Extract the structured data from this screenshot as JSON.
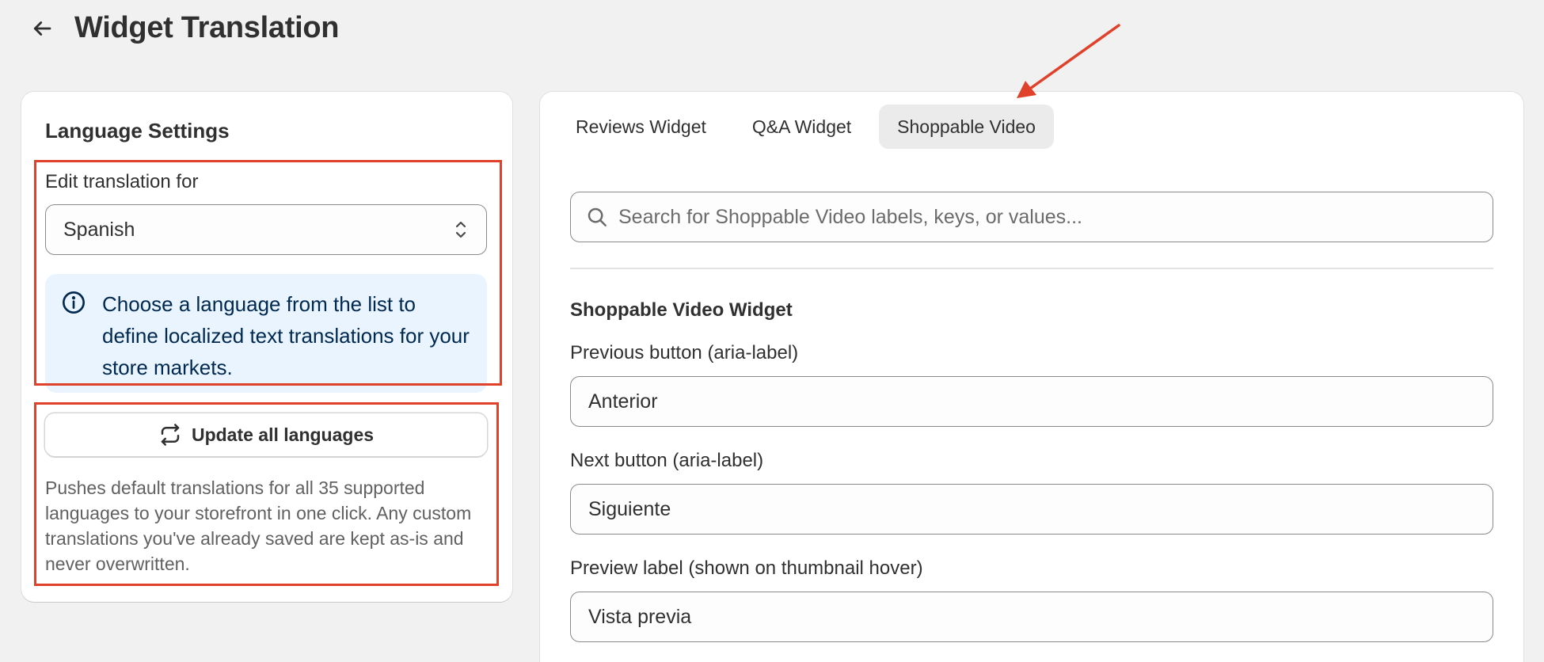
{
  "header": {
    "title": "Widget Translation",
    "back_icon": "arrow-left-icon"
  },
  "language_settings": {
    "title": "Language Settings",
    "edit_label": "Edit translation for",
    "selected_language": "Spanish",
    "info_text": "Choose a language from the list to define localized text translations for your store markets.",
    "update_button_label": "Update all languages",
    "help_text": "Pushes default translations for all 35 supported languages to your storefront in one click. Any custom translations you've already saved are kept as-is and never overwritten."
  },
  "tabs": [
    {
      "label": "Reviews Widget",
      "active": false
    },
    {
      "label": "Q&A Widget",
      "active": false
    },
    {
      "label": "Shoppable Video",
      "active": true
    }
  ],
  "search": {
    "placeholder": "Search for Shoppable Video labels, keys, or values..."
  },
  "translation_group": {
    "title": "Shoppable Video Widget",
    "fields": [
      {
        "label": "Previous button (aria-label)",
        "value": "Anterior"
      },
      {
        "label": "Next button (aria-label)",
        "value": "Siguiente"
      },
      {
        "label": "Preview label (shown on thumbnail hover)",
        "value": "Vista previa"
      }
    ]
  },
  "colors": {
    "annotation": "#e0412a",
    "info_banner_bg": "#eaf4ff",
    "active_tab_bg": "#ebebeb"
  }
}
